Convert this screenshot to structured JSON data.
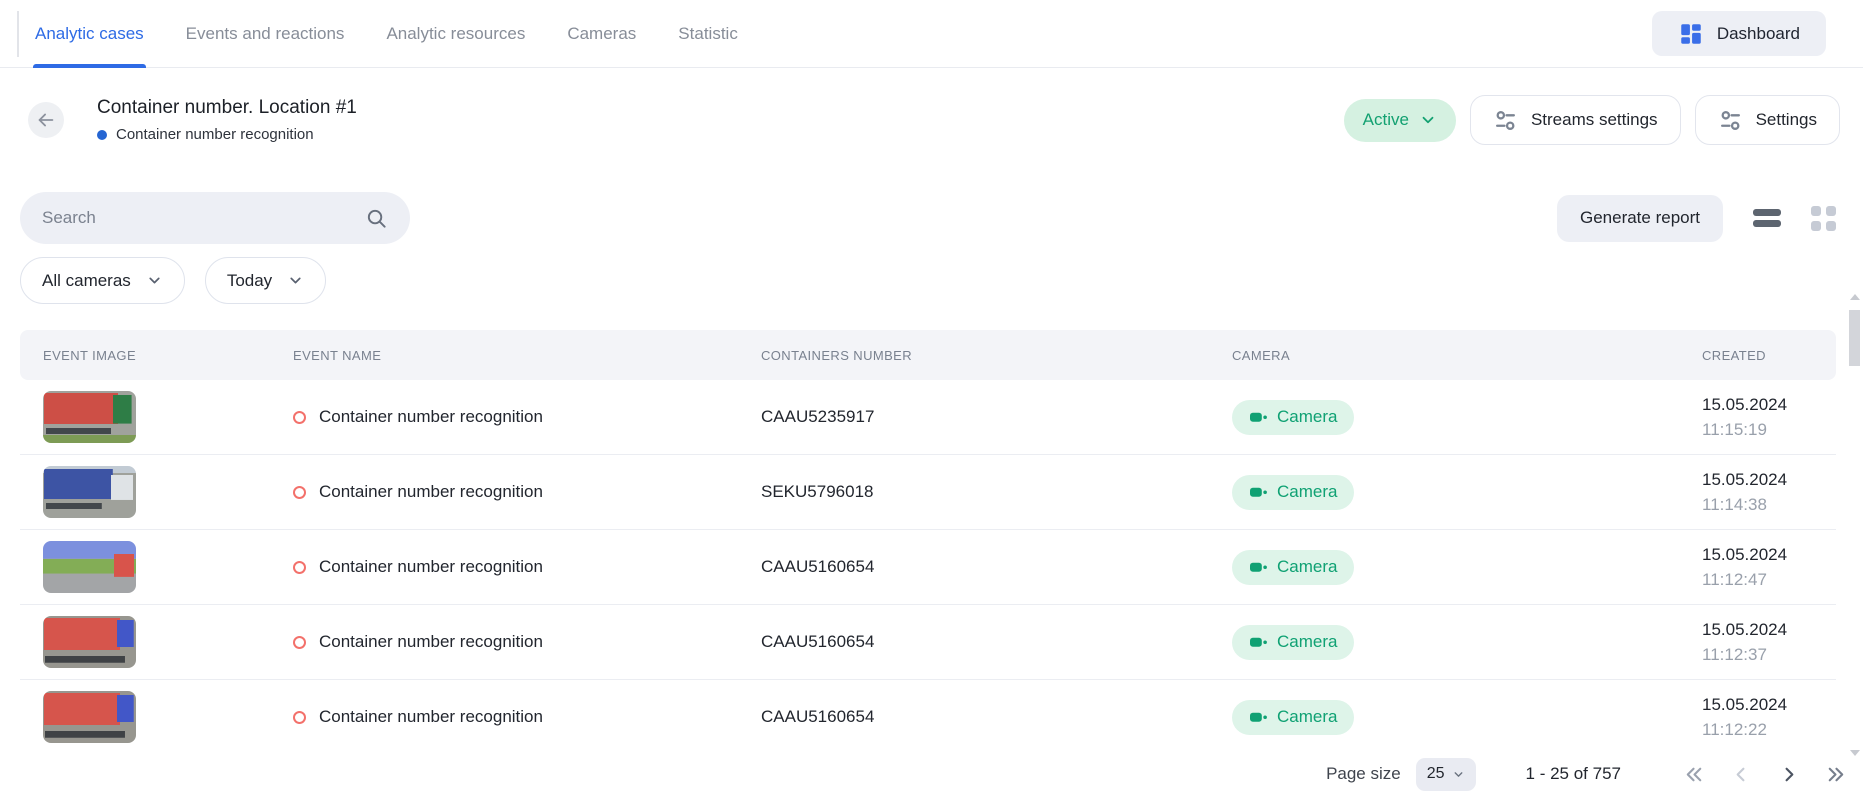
{
  "nav": {
    "tabs": [
      {
        "label": "Analytic cases",
        "active": true
      },
      {
        "label": "Events and reactions",
        "active": false
      },
      {
        "label": "Analytic resources",
        "active": false
      },
      {
        "label": "Cameras",
        "active": false
      },
      {
        "label": "Statistic",
        "active": false
      }
    ],
    "dashboard_label": "Dashboard"
  },
  "header": {
    "title": "Container number. Location #1",
    "subtitle": "Container number recognition",
    "status": "Active",
    "streams_settings_label": "Streams settings",
    "settings_label": "Settings"
  },
  "toolbar": {
    "search_placeholder": "Search",
    "generate_report_label": "Generate report"
  },
  "filters": {
    "cameras": "All cameras",
    "period": "Today"
  },
  "table": {
    "columns": [
      "EVENT IMAGE",
      "EVENT NAME",
      "CONTAINERS NUMBER",
      "CAMERA",
      "CREATED"
    ],
    "rows": [
      {
        "event_name": "Container number recognition",
        "container_number": "CAAU5235917",
        "camera": "Camera",
        "date": "15.05.2024",
        "time": "11:15:19",
        "thumb": "red-green"
      },
      {
        "event_name": "Container number recognition",
        "container_number": "SEKU5796018",
        "camera": "Camera",
        "date": "15.05.2024",
        "time": "11:14:38",
        "thumb": "blue-white"
      },
      {
        "event_name": "Container number recognition",
        "container_number": "CAAU5160654",
        "camera": "Camera",
        "date": "15.05.2024",
        "time": "11:12:47",
        "thumb": "road-red"
      },
      {
        "event_name": "Container number recognition",
        "container_number": "CAAU5160654",
        "camera": "Camera",
        "date": "15.05.2024",
        "time": "11:12:37",
        "thumb": "red-blue"
      },
      {
        "event_name": "Container number recognition",
        "container_number": "CAAU5160654",
        "camera": "Camera",
        "date": "15.05.2024",
        "time": "11:12:22",
        "thumb": "red-blue"
      }
    ]
  },
  "pagination": {
    "page_size_label": "Page size",
    "page_size": "25",
    "range": "1 - 25 of 757"
  },
  "colors": {
    "accent_blue": "#2e6be5",
    "status_green": "#0fa173",
    "status_green_bg": "#def4e9",
    "event_red": "#f3716b"
  }
}
